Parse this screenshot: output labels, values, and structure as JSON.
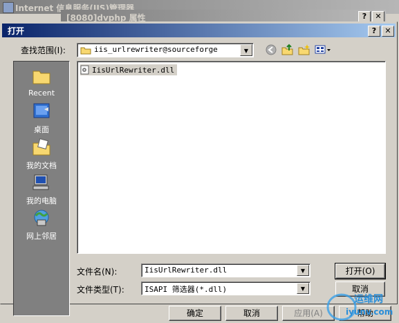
{
  "background": {
    "window1_title": "Internet 信息服务(IIS)管理器",
    "window2_title": "[8080]dvphp 属性",
    "help_btn": "?",
    "close_btn": "✕",
    "bottom_buttons": [
      "确定",
      "取消",
      "应用(A)",
      "帮助"
    ]
  },
  "dialog": {
    "title": "打开",
    "help_btn": "?",
    "close_btn": "✕",
    "look_in_label": "查找范围(I):",
    "look_in_value": "iis_urlrewriter@sourceforge",
    "places": [
      {
        "label": "Recent",
        "icon": "recent-folder-icon"
      },
      {
        "label": "桌面",
        "icon": "desktop-icon"
      },
      {
        "label": "我的文档",
        "icon": "my-documents-icon"
      },
      {
        "label": "我的电脑",
        "icon": "my-computer-icon"
      },
      {
        "label": "网上邻居",
        "icon": "network-icon"
      }
    ],
    "files": [
      {
        "name": "IisUrlRewriter.dll",
        "icon": "dll-file-icon"
      }
    ],
    "filename_label": "文件名(N):",
    "filename_value": "IisUrlRewriter.dll",
    "filetype_label": "文件类型(T):",
    "filetype_value": "ISAPI 筛选器(*.dll)",
    "open_button": "打开(O)",
    "cancel_button": "取消"
  },
  "watermark": {
    "text": "运维网",
    "sub": "iyunv.com"
  },
  "colors": {
    "title_active_start": "#0a246a",
    "title_active_end": "#a6caf0",
    "face": "#d4d0c8",
    "places_bg": "#808080"
  }
}
